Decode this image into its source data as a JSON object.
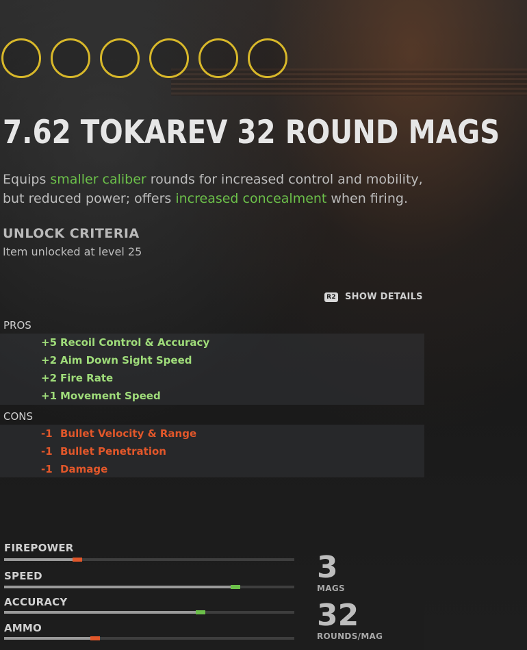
{
  "attachment": {
    "title": "7.62 TOKAREV 32 ROUND MAGS",
    "description_parts": [
      {
        "text": "Equips ",
        "highlight": false
      },
      {
        "text": "smaller caliber",
        "highlight": true
      },
      {
        "text": " rounds for increased control and mobility, but reduced power; offers ",
        "highlight": false
      },
      {
        "text": "increased concealment",
        "highlight": true
      },
      {
        "text": " when firing.",
        "highlight": false
      }
    ]
  },
  "unlock": {
    "heading": "UNLOCK CRITERIA",
    "text": "Item unlocked at level 25"
  },
  "details_button": {
    "key": "R2",
    "label": "SHOW DETAILS"
  },
  "pros": {
    "label": "PROS",
    "items": [
      {
        "value": "+5",
        "name": "Recoil Control & Accuracy"
      },
      {
        "value": "+2",
        "name": "Aim Down Sight Speed"
      },
      {
        "value": "+2",
        "name": "Fire Rate"
      },
      {
        "value": "+1",
        "name": "Movement Speed"
      }
    ]
  },
  "cons": {
    "label": "CONS",
    "items": [
      {
        "value": "-1",
        "name": "Bullet Velocity & Range"
      },
      {
        "value": "-1",
        "name": "Bullet Penetration"
      },
      {
        "value": "-1",
        "name": "Damage"
      }
    ]
  },
  "stats": [
    {
      "label": "FIREPOWER",
      "fraction": 0.27,
      "change": "decrease"
    },
    {
      "label": "SPEED",
      "fraction": 0.78,
      "change": "increase"
    },
    {
      "label": "ACCURACY",
      "fraction": 0.66,
      "change": "increase"
    },
    {
      "label": "AMMO",
      "fraction": 0.33,
      "change": "decrease"
    }
  ],
  "ammo": {
    "mags_value": "3",
    "mags_label": "MAGS",
    "rounds_value": "32",
    "rounds_label": "ROUNDS/MAG"
  },
  "colors": {
    "accent_yellow": "#d8b82a",
    "positive": "#9fdc7a",
    "negative": "#e2572a",
    "highlight": "#6cc04a"
  },
  "attachment_slots": 6
}
